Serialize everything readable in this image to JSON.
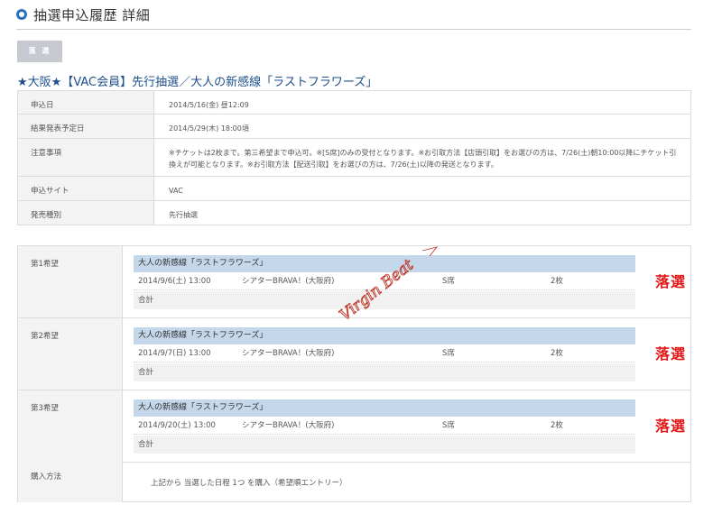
{
  "header": {
    "title": "抽選申込履歴 詳細"
  },
  "status_tag": {
    "label": "落 選"
  },
  "event": {
    "title": "★大阪★【VAC会員】先行抽選／大人の新感線「ラストフラワーズ」"
  },
  "info_table": {
    "rows": [
      {
        "label": "申込日",
        "value": "2014/5/16(金) 昼12:09"
      },
      {
        "label": "結果発表予定日",
        "value": "2014/5/29(木) 18:00頃"
      },
      {
        "label": "注意事項",
        "value": "※チケットは2枚まで。第三希望まで申込可。※[S席]のみの受付となります。※お引取方法【店頭引取】をお選びの方は、7/26(土)朝10:00以降にチケット引換えが可能となります。※お引取方法【配送引取】をお選びの方は、7/26(土)以降の発送となります。"
      },
      {
        "label": "申込サイト",
        "value": "VAC"
      },
      {
        "label": "発売種別",
        "value": "先行抽選"
      }
    ]
  },
  "wishes": [
    {
      "label": "第1希望",
      "title": "大人の新感線「ラストフラワーズ」",
      "date": "2014/9/6(土) 13:00",
      "venue": "シアターBRAVA！(大阪府)",
      "seat": "S席",
      "qty": "2枚",
      "total_label": "合計",
      "result": "落選"
    },
    {
      "label": "第2希望",
      "title": "大人の新感線「ラストフラワーズ」",
      "date": "2014/9/7(日) 13:00",
      "venue": "シアターBRAVA！(大阪府)",
      "seat": "S席",
      "qty": "2枚",
      "total_label": "合計",
      "result": "落選"
    },
    {
      "label": "第3希望",
      "title": "大人の新感線「ラストフラワーズ」",
      "date": "2014/9/20(土) 13:00",
      "venue": "シアターBRAVA！(大阪府)",
      "seat": "S席",
      "qty": "2枚",
      "total_label": "合計",
      "result": "落選"
    }
  ],
  "purchase": {
    "label": "購入方法",
    "text": "上記から 当選した日程 1つ を購入（希望順エントリー）"
  },
  "watermark": {
    "text": "Virgin Beat"
  },
  "colors": {
    "accent_blue": "#2a72b8",
    "title_blue": "#1c4f8c",
    "result_red": "#e4191b",
    "bar_blue": "#c5d7ea",
    "tag_gray": "#c6c9cf"
  }
}
